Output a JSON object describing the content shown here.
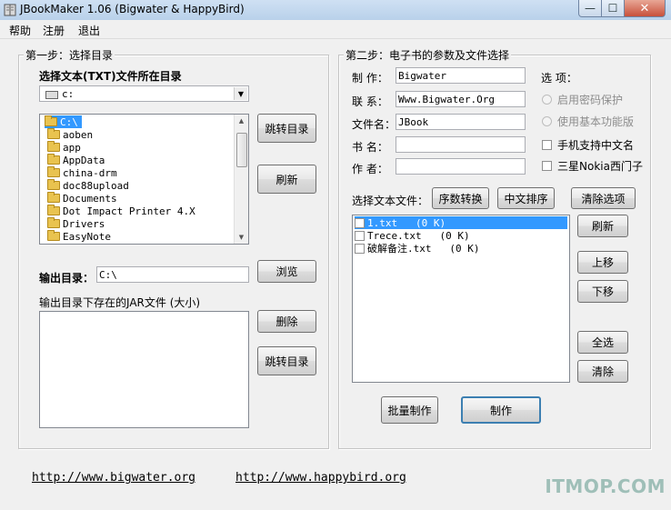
{
  "window": {
    "title": "JBookMaker 1.06 (Bigwater & HappyBird)",
    "close_glyph": "✕",
    "min_glyph": "—",
    "max_glyph": "☐"
  },
  "menu": [
    "帮助",
    "注册",
    "退出"
  ],
  "step1": {
    "title": "第一步：选择目录",
    "dir_label": "选择文本(TXT)文件所在目录",
    "drive_value": "c:",
    "tree": [
      "C:\\",
      "aoben",
      "app",
      "AppData",
      "china-drm",
      "doc88upload",
      "Documents",
      "Dot Impact Printer 4.X",
      "Drivers",
      "EasyNote"
    ],
    "btn_goto_dir": "跳转目录",
    "btn_refresh": "刷新",
    "output_label": "输出目录：",
    "output_value": "C:\\",
    "btn_browse": "浏览",
    "jar_label": "输出目录下存在的JAR文件 (大小)",
    "btn_delete": "删除",
    "btn_goto_dir2": "跳转目录"
  },
  "step2": {
    "title": "第二步：电子书的参数及文件选择",
    "fields": [
      {
        "label": "制  作：",
        "value": "Bigwater"
      },
      {
        "label": "联  系：",
        "value": "Www.Bigwater.Org"
      },
      {
        "label": "文件名：",
        "value": "JBook"
      },
      {
        "label": "书  名：",
        "value": ""
      },
      {
        "label": "作  者：",
        "value": ""
      }
    ],
    "options_label": "选  项：",
    "options": [
      {
        "label": "启用密码保护",
        "kind": "radio",
        "enabled": false
      },
      {
        "label": "使用基本功能版",
        "kind": "radio",
        "enabled": false
      },
      {
        "label": "手机支持中文名",
        "kind": "check",
        "enabled": true
      },
      {
        "label": "三星Nokia西门子",
        "kind": "check",
        "enabled": true
      }
    ],
    "select_files_label": "选择文本文件：",
    "btn_seq_convert": "序数转换",
    "btn_cn_sort": "中文排序",
    "btn_clear_options": "清除选项",
    "files": [
      "1.txt   (0 K)",
      "Trece.txt   (0 K)",
      "破解备注.txt   (0 K)"
    ],
    "btn_refresh": "刷新",
    "btn_up": "上移",
    "btn_down": "下移",
    "btn_select_all": "全选",
    "btn_clear": "清除",
    "btn_batch_make": "批量制作",
    "btn_make": "制作"
  },
  "links": [
    "http://www.bigwater.org",
    "http://www.happybird.org"
  ],
  "watermark": "ITMOP.COM"
}
